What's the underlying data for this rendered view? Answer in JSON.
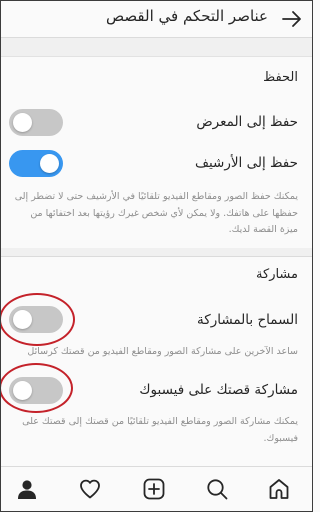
{
  "header": {
    "title": "عناصر التحكم في القصص",
    "back_icon": "arrow-right-icon"
  },
  "save_section": {
    "title": "الحفظ",
    "save_to_gallery": {
      "label": "حفظ إلى المعرض",
      "on": false
    },
    "save_to_archive": {
      "label": "حفظ إلى الأرشيف",
      "on": true
    },
    "description": "يمكنك حفظ الصور ومقاطع الفيديو تلقائيًا في الأرشيف حتى لا تضطر إلى حفظها على هاتفك. ولا يمكن لأي شخص غيرك رؤيتها بعد اختفائها من ميزة القصة لديك."
  },
  "sharing_section": {
    "title": "مشاركة",
    "allow_sharing": {
      "label": "السماح بالمشاركة",
      "on": false,
      "description": "ساعد الآخرين على مشاركة الصور ومقاطع الفيديو من قصتك كرسائل"
    },
    "share_to_facebook": {
      "label": "مشاركة قصتك على فيسبوك",
      "on": false,
      "description": "يمكنك مشاركة الصور ومقاطع الفيديو تلقائيًا من قصتك إلى قصتك على فيسبوك."
    }
  },
  "annotation_color": "#c4222a",
  "accent_color": "#3897f0",
  "bottom_nav": [
    "profile-icon",
    "heart-icon",
    "add-post-icon",
    "search-icon",
    "home-icon"
  ]
}
